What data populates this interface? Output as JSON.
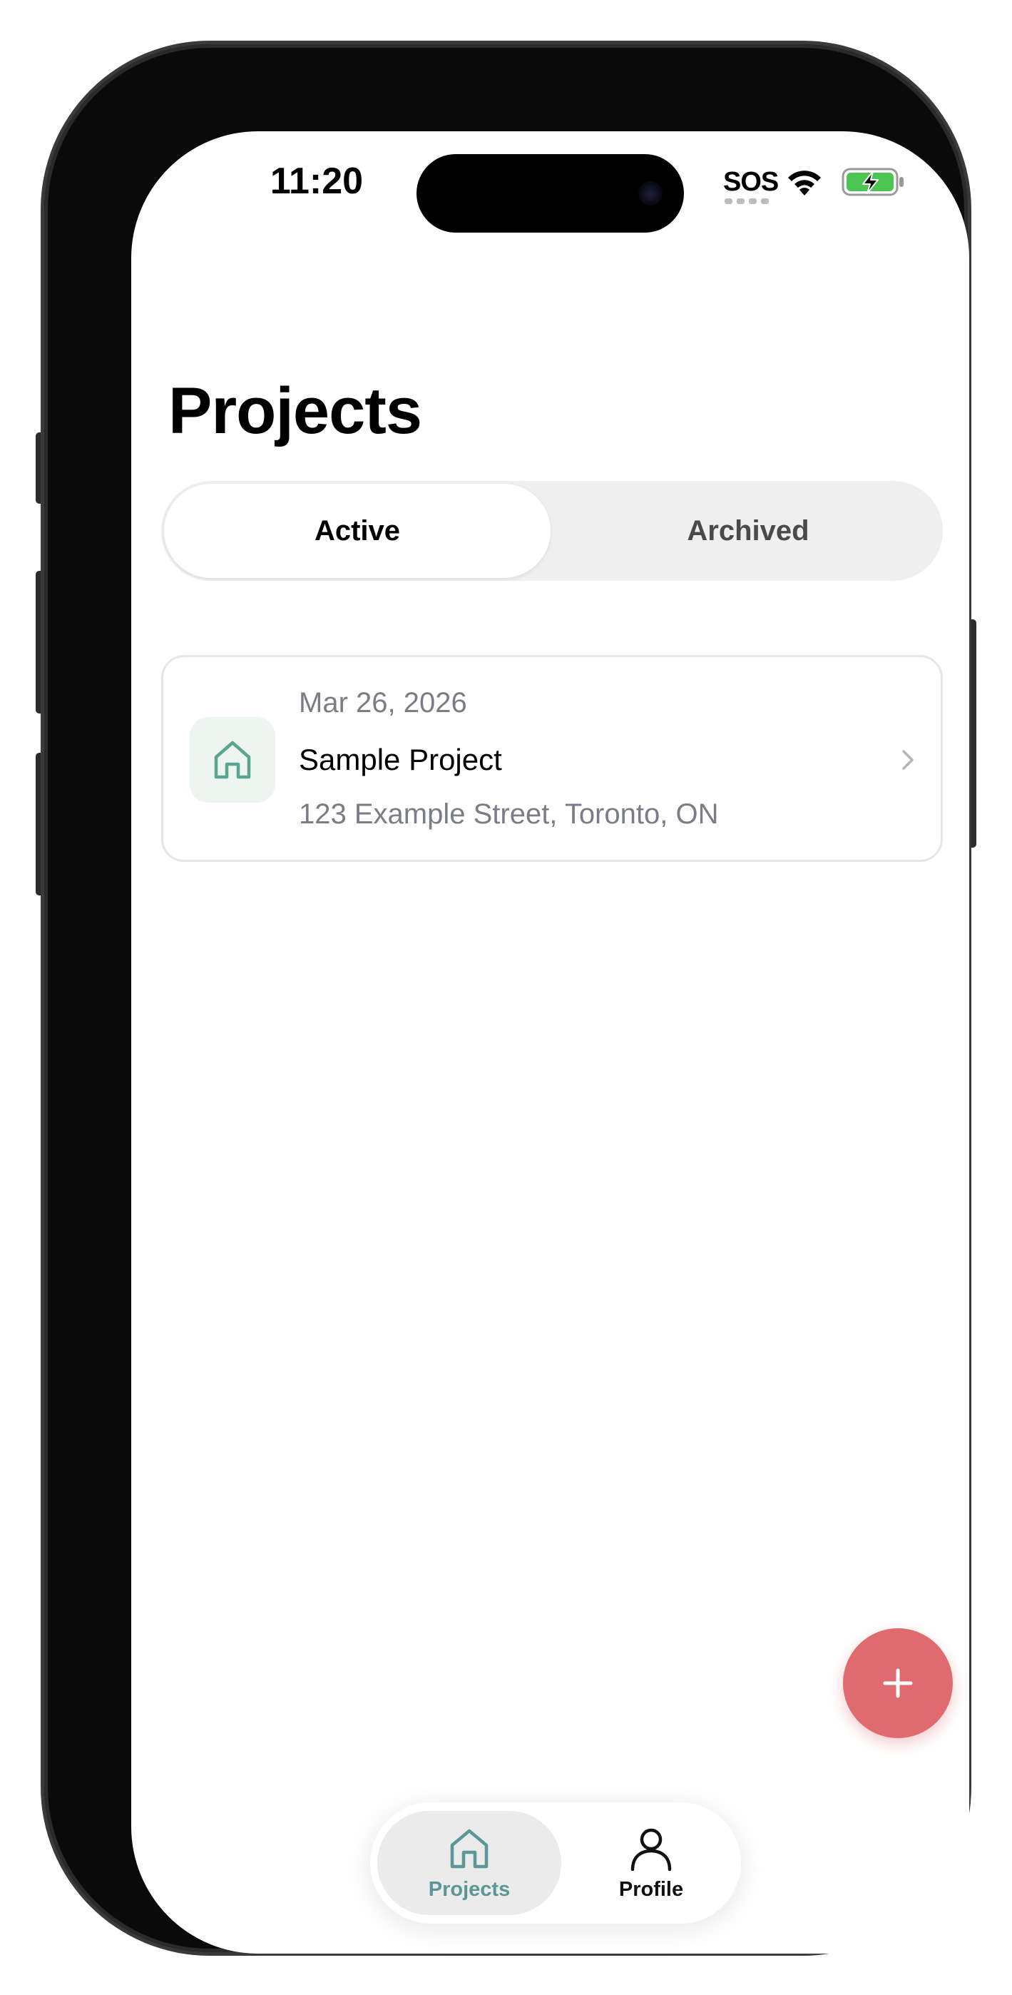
{
  "status_bar": {
    "time": "11:20",
    "carrier_status": "SOS"
  },
  "header": {
    "title": "Projects"
  },
  "segmented_control": {
    "options": [
      "Active",
      "Archived"
    ],
    "selected": "Active"
  },
  "projects": [
    {
      "date": "Mar 26, 2026",
      "name": "Sample Project",
      "address": "123 Example Street, Toronto, ON",
      "icon": "home-icon"
    }
  ],
  "fab": {
    "icon": "plus-icon",
    "color": "#df6b6e"
  },
  "tab_bar": {
    "items": [
      {
        "label": "Projects",
        "icon": "home-icon",
        "selected": true
      },
      {
        "label": "Profile",
        "icon": "user-icon",
        "selected": false
      }
    ]
  },
  "colors": {
    "accent_teal": "#5b9797",
    "icon_green": "#5aa58f",
    "muted_text": "#7a7d87",
    "fab_red": "#df6b6e"
  }
}
